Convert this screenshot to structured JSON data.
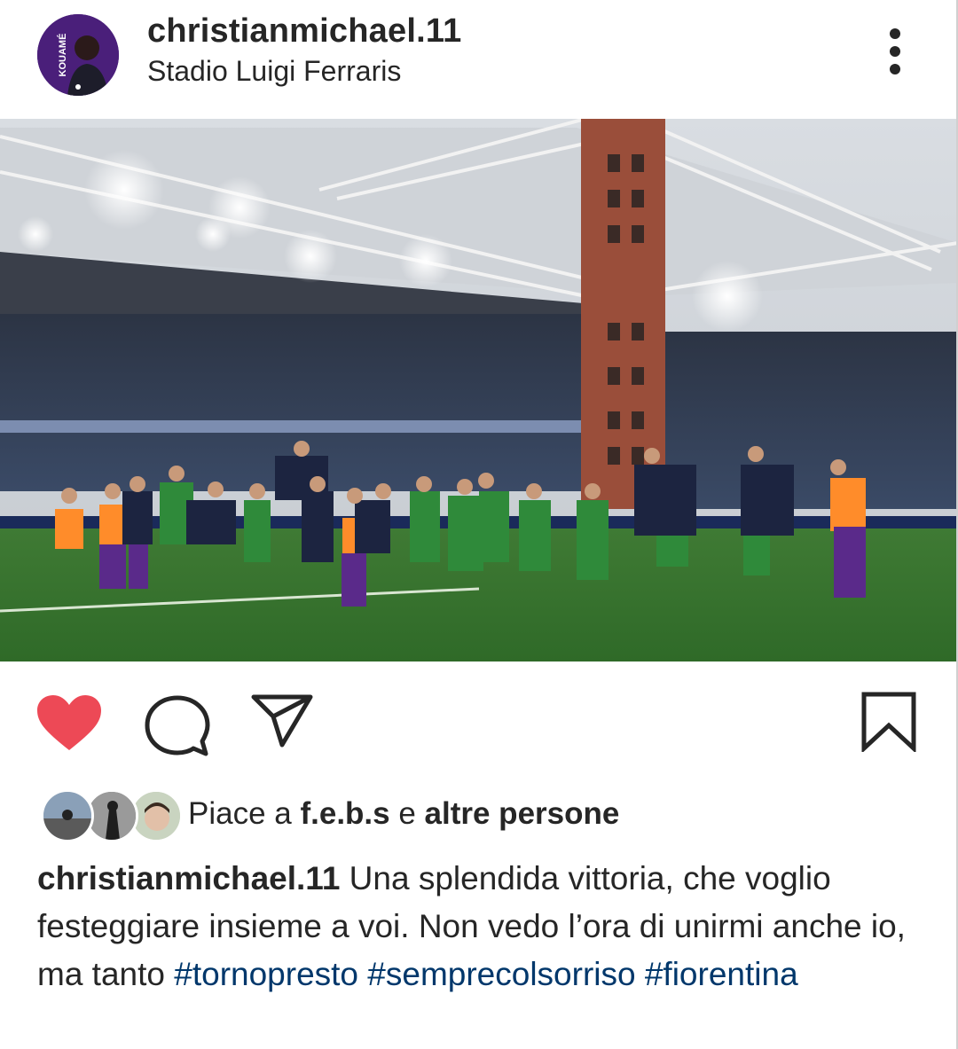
{
  "post": {
    "username": "christianmichael.11",
    "location": "Stadio Luigi Ferraris",
    "avatar_text": "KOUAMÉ",
    "more_icon": "more-vertical-icon"
  },
  "actions": {
    "like_icon": "heart-filled-icon",
    "comment_icon": "comment-icon",
    "share_icon": "send-icon",
    "save_icon": "bookmark-icon",
    "like_color": "#ed4956"
  },
  "likes": {
    "prefix": "Piace a ",
    "user": "f.e.b.s",
    "middle": " e ",
    "others": "altre persone"
  },
  "caption": {
    "user": "christianmichael.11",
    "text": " Una splendida vittoria, che voglio festeggiare insieme a voi. Non vedo l’ora di unirmi anche io, ma tanto ",
    "hashtags": [
      "#tornopresto",
      "#sempre­colsorriso",
      "#fiorentina"
    ]
  },
  "colors": {
    "text": "#262626",
    "hashtag": "#00376b",
    "avatar_bg": "#4a1f7a"
  }
}
